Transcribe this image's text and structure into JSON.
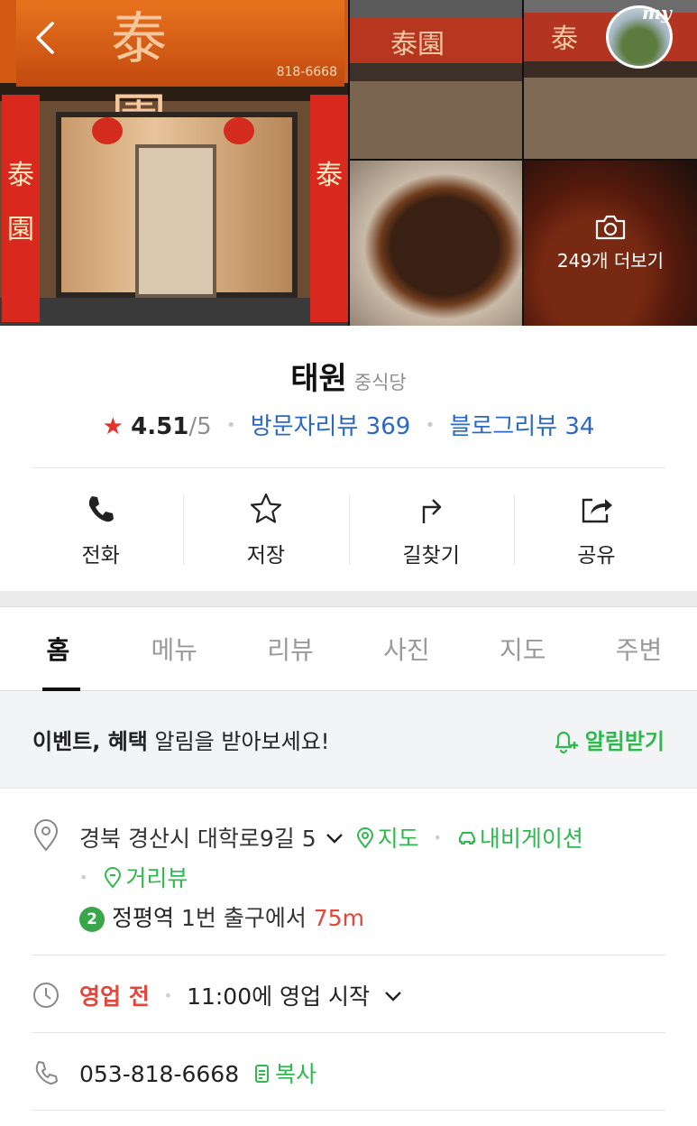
{
  "gallery": {
    "more_label": "249개 더보기",
    "profile_badge": "my",
    "sign_chinese": "泰園",
    "sign_phone": "818-6668",
    "banner_chinese_left": "泰園",
    "banner_chinese_right": "泰",
    "thumb_sign_1": "泰園",
    "thumb_sign_2": "泰"
  },
  "place": {
    "name": "태원",
    "category": "중식당",
    "rating_star": "★",
    "rating": "4.51",
    "rating_max": "/5",
    "visitor_reviews": "방문자리뷰 369",
    "blog_reviews": "블로그리뷰 34"
  },
  "actions": [
    {
      "label": "전화",
      "icon": "phone-icon"
    },
    {
      "label": "저장",
      "icon": "star-icon"
    },
    {
      "label": "길찾기",
      "icon": "directions-icon"
    },
    {
      "label": "공유",
      "icon": "share-icon"
    }
  ],
  "tabs": [
    {
      "label": "홈",
      "active": true
    },
    {
      "label": "메뉴",
      "active": false
    },
    {
      "label": "리뷰",
      "active": false
    },
    {
      "label": "사진",
      "active": false
    },
    {
      "label": "지도",
      "active": false
    },
    {
      "label": "주변",
      "active": false
    }
  ],
  "notice": {
    "bold_text": "이벤트, 혜택",
    "text": " 알림을 받아보세요!",
    "cta": "알림받기"
  },
  "info": {
    "address": "경북 경산시 대학로9길 5",
    "map_link": "지도",
    "navigation_link": "내비게이션",
    "street_view_link": "거리뷰",
    "subway_line": "2",
    "subway_station": "정평역",
    "subway_exit": " 1번 출구에서 ",
    "subway_distance": "75m",
    "status": "영업 전",
    "hours": "11:00에 영업 시작",
    "phone": "053-818-6668",
    "copy_label": "복사"
  },
  "colors": {
    "accent_green": "#2eb94e",
    "link_blue": "#2b68c4",
    "alert_red": "#e5453a",
    "star_red": "#e5322b"
  }
}
